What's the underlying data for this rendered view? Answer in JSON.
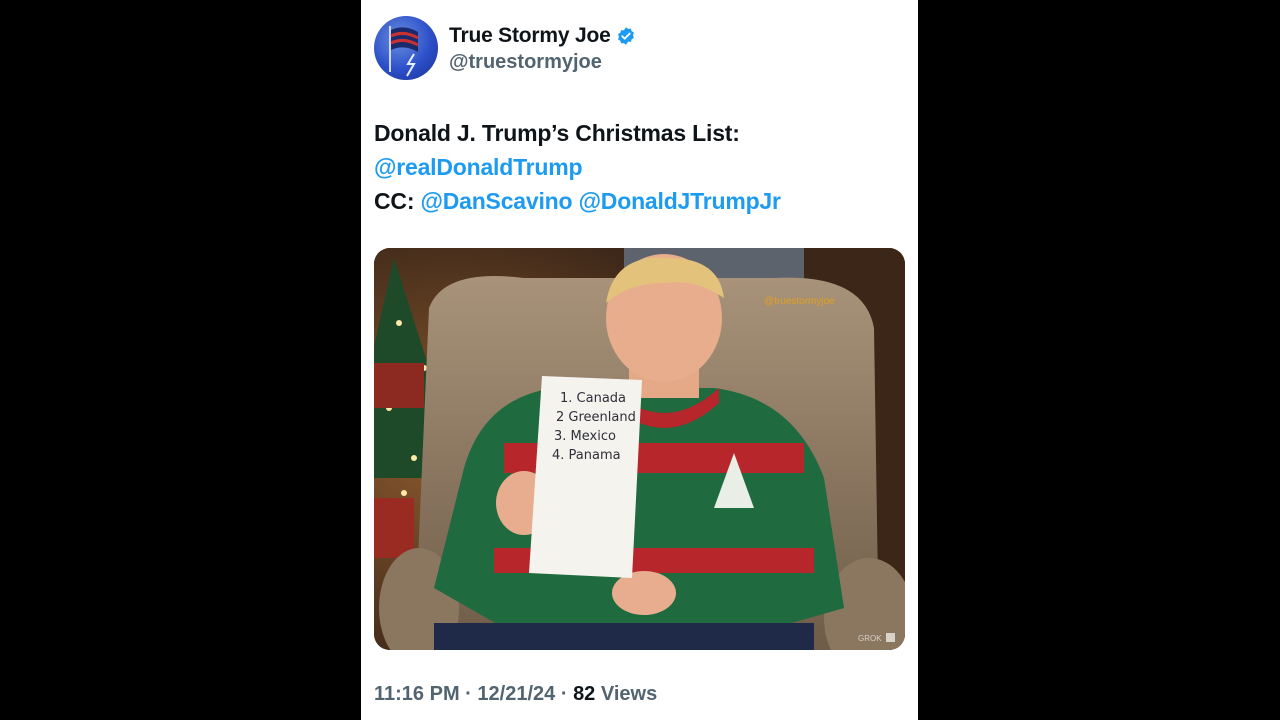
{
  "author": {
    "display_name": "True Stormy Joe",
    "handle": "@truestormyjoe",
    "verified_icon": "verified-badge-icon",
    "avatar_icon": "flag-lightning-avatar"
  },
  "tweet": {
    "line1": "Donald J. Trump’s Christmas List:",
    "mention1": "@realDonaldTrump",
    "cc_label": "CC:",
    "mention2": "@DanScavino",
    "mention3": "@DonaldJTrumpJr"
  },
  "media": {
    "watermark": "@truestormyjoe",
    "grok_label": "GROK",
    "list": [
      "1. Canada",
      "2 Greenland",
      "3. Mexico",
      "4. Panama"
    ]
  },
  "meta": {
    "time": "11:16 PM",
    "date": "12/21/24",
    "views_count": "82",
    "views_label": "Views",
    "separator": "·"
  },
  "colors": {
    "accent": "#1d9bf0",
    "text": "#0f1419",
    "muted": "#536471"
  }
}
